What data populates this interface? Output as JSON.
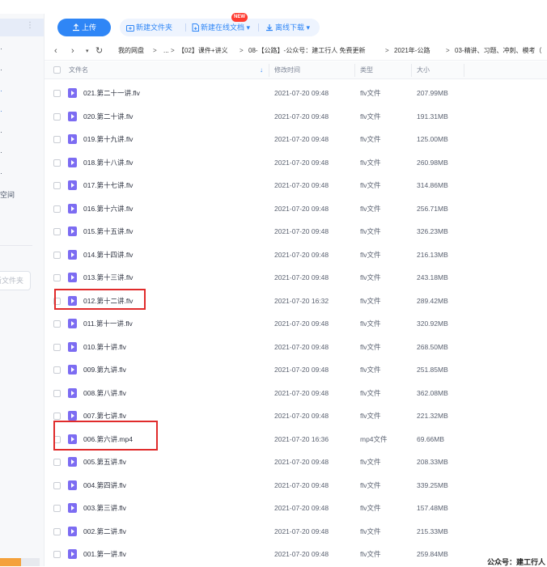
{
  "toolbar": {
    "upload_label": "上传",
    "new_folder_label": "新建文件夹",
    "new_online_doc_label": "新建在线文档",
    "new_badge": "NEW",
    "offline_download_label": "离线下载"
  },
  "sidebar": {
    "fragments": [
      "空间",
      "新文件夹"
    ]
  },
  "breadcrumb": {
    "items": [
      "我的网盘",
      "...",
      "【02】课件+讲义",
      "08-【公路】-公众号：建工行人 免费更新",
      "2021年-公路",
      "03-精讲、习题、冲刺、模考（"
    ],
    "separator": ">"
  },
  "table": {
    "headers": {
      "name": "文件名",
      "mtime": "修改时间",
      "type": "类型",
      "size": "大小"
    },
    "rows": [
      {
        "name": "021.第二十一讲.flv",
        "mtime": "2021-07-20 09:48",
        "type": "flv文件",
        "size": "207.99MB"
      },
      {
        "name": "020.第二十讲.flv",
        "mtime": "2021-07-20 09:48",
        "type": "flv文件",
        "size": "191.31MB"
      },
      {
        "name": "019.第十九讲.flv",
        "mtime": "2021-07-20 09:48",
        "type": "flv文件",
        "size": "125.00MB"
      },
      {
        "name": "018.第十八讲.flv",
        "mtime": "2021-07-20 09:48",
        "type": "flv文件",
        "size": "260.98MB"
      },
      {
        "name": "017.第十七讲.flv",
        "mtime": "2021-07-20 09:48",
        "type": "flv文件",
        "size": "314.86MB"
      },
      {
        "name": "016.第十六讲.flv",
        "mtime": "2021-07-20 09:48",
        "type": "flv文件",
        "size": "256.71MB"
      },
      {
        "name": "015.第十五讲.flv",
        "mtime": "2021-07-20 09:48",
        "type": "flv文件",
        "size": "326.23MB"
      },
      {
        "name": "014.第十四讲.flv",
        "mtime": "2021-07-20 09:48",
        "type": "flv文件",
        "size": "216.13MB"
      },
      {
        "name": "013.第十三讲.flv",
        "mtime": "2021-07-20 09:48",
        "type": "flv文件",
        "size": "243.18MB"
      },
      {
        "name": "012.第十二讲.flv",
        "mtime": "2021-07-20 16:32",
        "type": "flv文件",
        "size": "289.42MB"
      },
      {
        "name": "011.第十一讲.flv",
        "mtime": "2021-07-20 09:48",
        "type": "flv文件",
        "size": "320.92MB"
      },
      {
        "name": "010.第十讲.flv",
        "mtime": "2021-07-20 09:48",
        "type": "flv文件",
        "size": "268.50MB"
      },
      {
        "name": "009.第九讲.flv",
        "mtime": "2021-07-20 09:48",
        "type": "flv文件",
        "size": "251.85MB"
      },
      {
        "name": "008.第八讲.flv",
        "mtime": "2021-07-20 09:48",
        "type": "flv文件",
        "size": "362.08MB"
      },
      {
        "name": "007.第七讲.flv",
        "mtime": "2021-07-20 09:48",
        "type": "flv文件",
        "size": "221.32MB"
      },
      {
        "name": "006.第六讲.mp4",
        "mtime": "2021-07-20 16:36",
        "type": "mp4文件",
        "size": "69.66MB"
      },
      {
        "name": "005.第五讲.flv",
        "mtime": "2021-07-20 09:48",
        "type": "flv文件",
        "size": "208.33MB"
      },
      {
        "name": "004.第四讲.flv",
        "mtime": "2021-07-20 09:48",
        "type": "flv文件",
        "size": "339.25MB"
      },
      {
        "name": "003.第三讲.flv",
        "mtime": "2021-07-20 09:48",
        "type": "flv文件",
        "size": "157.48MB"
      },
      {
        "name": "002.第二讲.flv",
        "mtime": "2021-07-20 09:48",
        "type": "flv文件",
        "size": "215.33MB"
      },
      {
        "name": "001.第一讲.flv",
        "mtime": "2021-07-20 09:48",
        "type": "flv文件",
        "size": "259.84MB"
      }
    ]
  },
  "watermark": "公众号：建工行人",
  "colors": {
    "accent": "#2f86f6",
    "highlight": "#e02b2b",
    "video_icon": "#7c6cf2"
  }
}
